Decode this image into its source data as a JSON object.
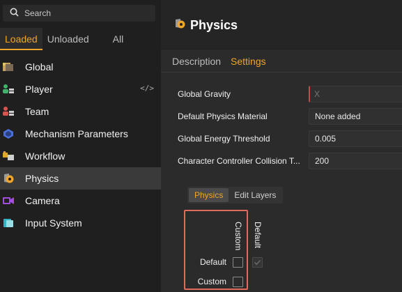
{
  "search": {
    "placeholder": "Search"
  },
  "tabs": [
    "Loaded",
    "Unloaded",
    "All"
  ],
  "sidebar": {
    "items": [
      {
        "label": "Global",
        "icon": "global-icon"
      },
      {
        "label": "Player",
        "icon": "player-icon",
        "code": "</>"
      },
      {
        "label": "Team",
        "icon": "team-icon"
      },
      {
        "label": "Mechanism Parameters",
        "icon": "mechanism-icon"
      },
      {
        "label": "Workflow",
        "icon": "workflow-icon"
      },
      {
        "label": "Physics",
        "icon": "physics-icon",
        "selected": true
      },
      {
        "label": "Camera",
        "icon": "camera-icon"
      },
      {
        "label": "Input System",
        "icon": "input-system-icon"
      }
    ]
  },
  "main": {
    "title": "Physics",
    "subtabs": [
      "Description",
      "Settings"
    ],
    "settings": [
      {
        "label": "Global Gravity",
        "value": "X"
      },
      {
        "label": "Default Physics Material",
        "value": "None added"
      },
      {
        "label": "Global Energy Threshold",
        "value": "0.005"
      },
      {
        "label": "Character Controller Collision T...",
        "value": "200"
      }
    ],
    "layer_tabs": [
      "Physics",
      "Edit Layers"
    ],
    "matrix": {
      "columns": [
        "Custom",
        "Default"
      ],
      "rows": [
        "Default",
        "Custom"
      ]
    }
  },
  "colors": {
    "accent": "#f0a52b",
    "highlight_box": "#e06c5e"
  }
}
